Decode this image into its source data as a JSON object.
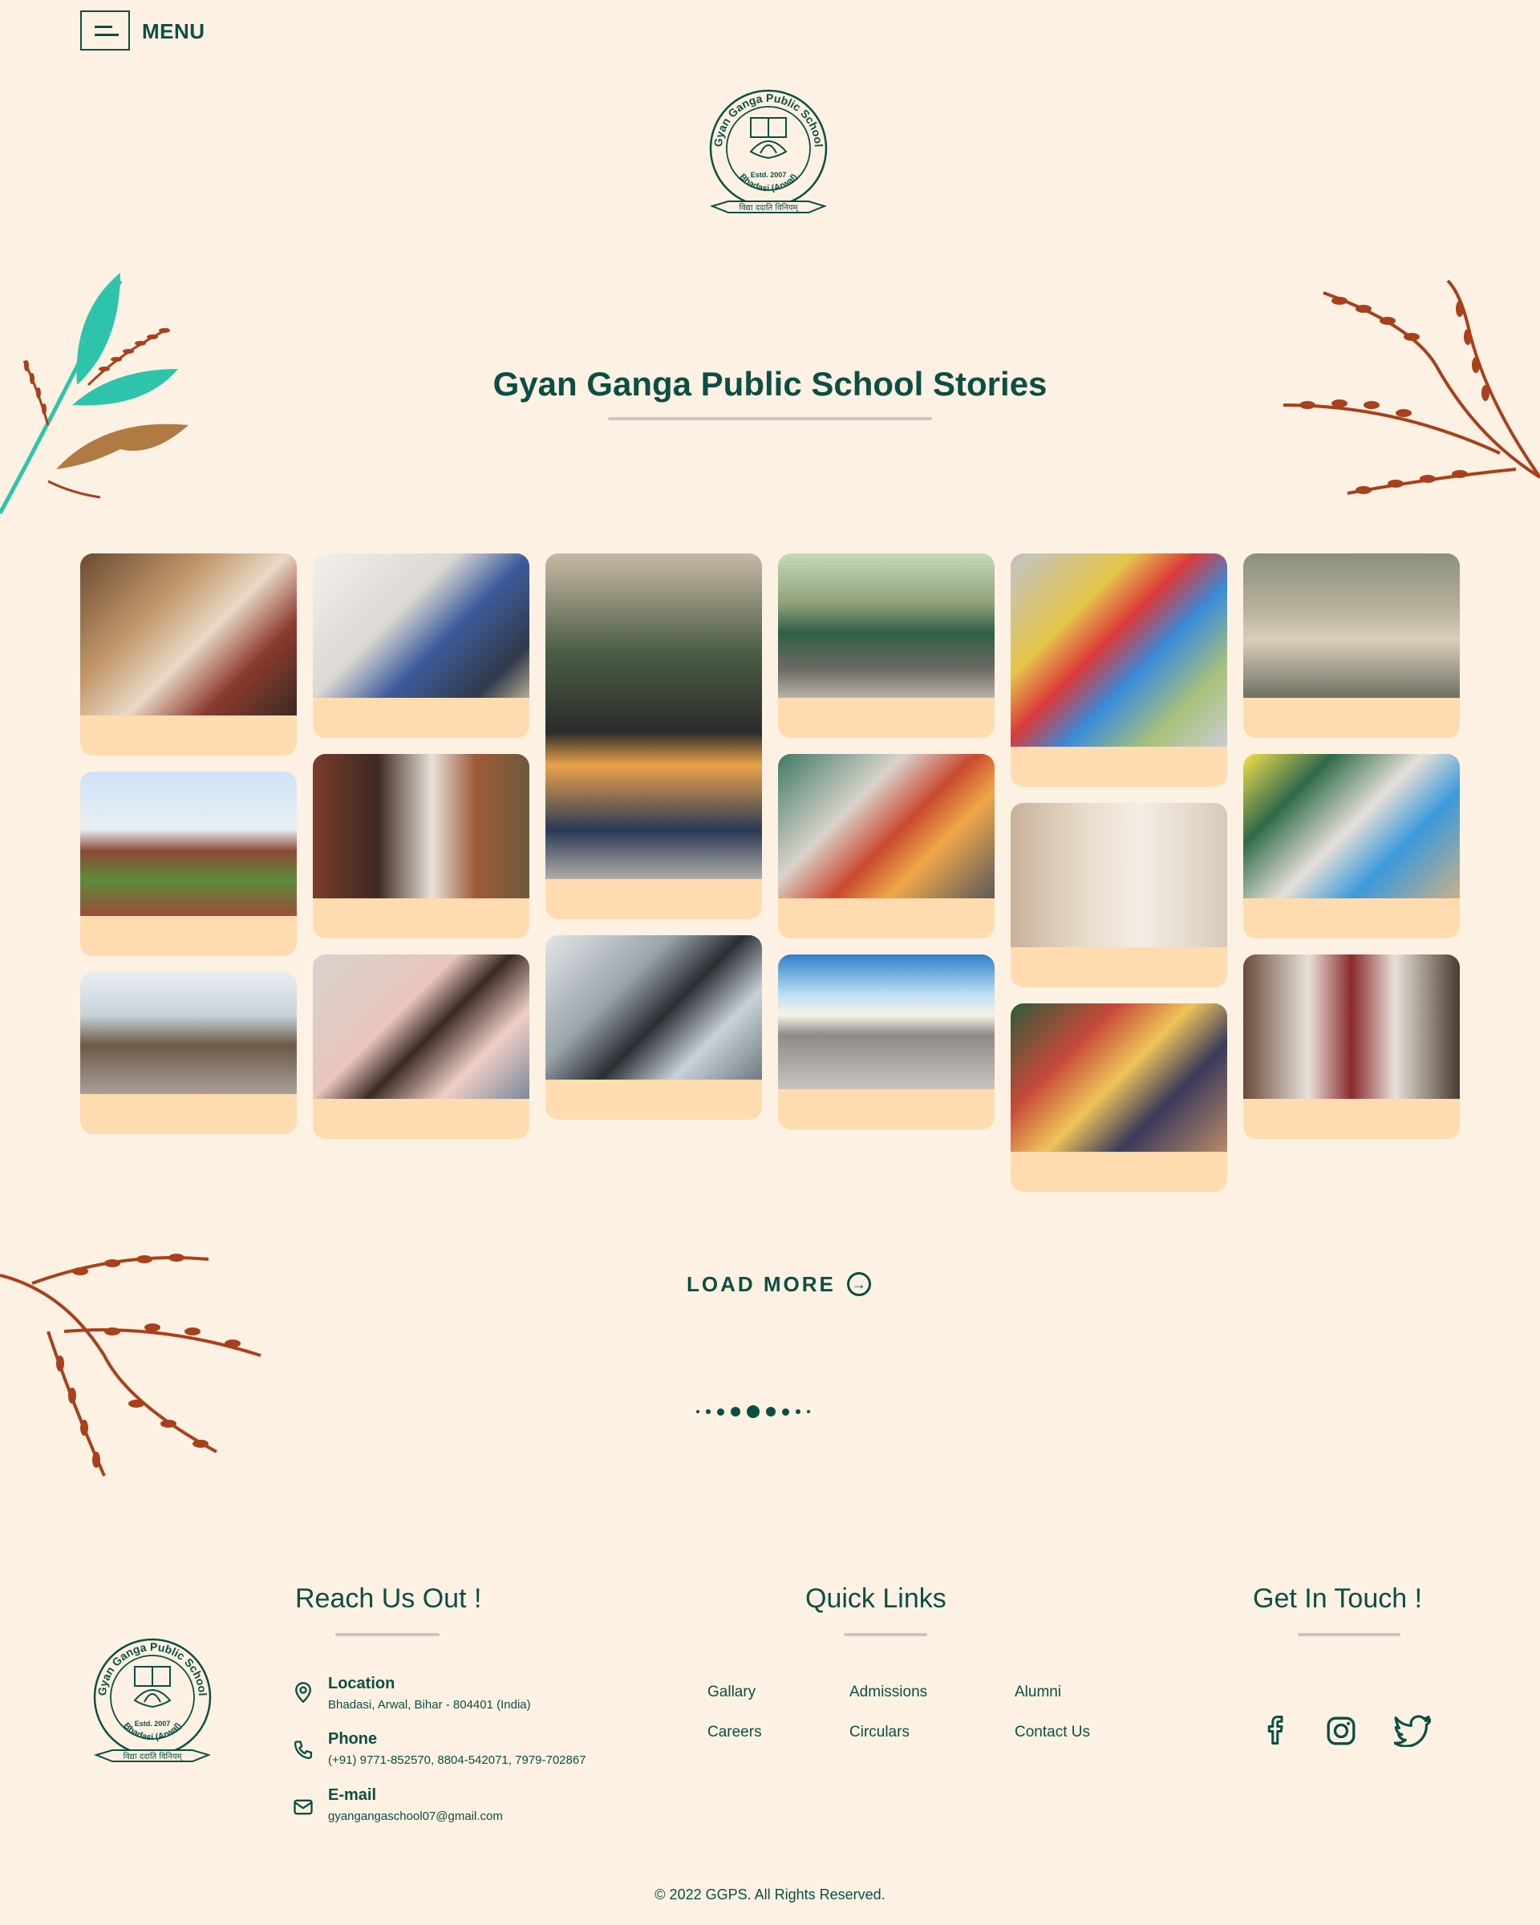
{
  "header": {
    "menu_label": "MENU"
  },
  "logo": {
    "name": "Gyan Ganga Public School",
    "estd": "Estd. 2007",
    "place": "Bhadasi (Arwal)",
    "motto": "विद्या ददाति विनियम्"
  },
  "page": {
    "title": "Gyan Ganga Public School Stories"
  },
  "gallery": {
    "load_more": "LOAD MORE"
  },
  "footer": {
    "reach_title": "Reach Us Out !",
    "quick_title": "Quick Links",
    "touch_title": "Get In Touch !",
    "contact": [
      {
        "label": "Location",
        "value": "Bhadasi, Arwal, Bihar - 804401 (India)",
        "icon": "location-pin-icon"
      },
      {
        "label": "Phone",
        "value": "(+91) 9771-852570, 8804-542071, 7979-702867",
        "icon": "phone-icon"
      },
      {
        "label": "E-mail",
        "value": "gyangangaschool07@gmail.com",
        "icon": "mail-icon"
      }
    ],
    "links": [
      "Gallary",
      "Admissions",
      "Alumni",
      "Careers",
      "Circulars",
      "Contact Us"
    ],
    "social": [
      "facebook-icon",
      "instagram-icon",
      "twitter-icon"
    ],
    "copyright": "© 2022 GGPS. All Rights Reserved."
  },
  "colors": {
    "primary": "#0b4f42",
    "background": "#fdf1e4",
    "card": "#ffdcb0",
    "leaf_rust": "#a8401b",
    "leaf_teal": "#2ec4ac",
    "leaf_brown": "#b07a43"
  }
}
